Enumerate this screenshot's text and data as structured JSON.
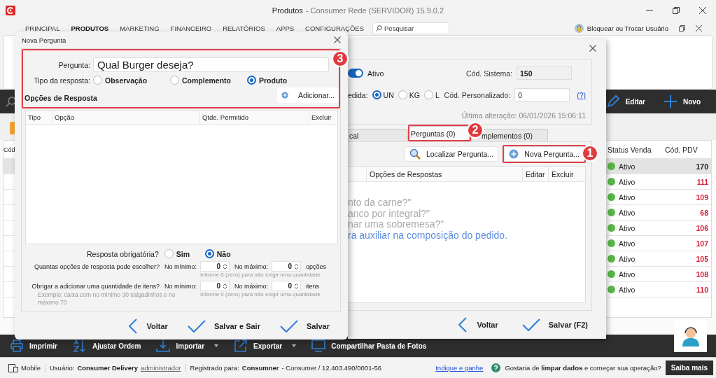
{
  "window": {
    "title": "Produtos",
    "subtitle": "- Consumer Rede (SERVIDOR) 15.9.0.2"
  },
  "menu": {
    "tabs": [
      {
        "label": "PRINCIPAL",
        "selected": false
      },
      {
        "label": "PRODUTOS",
        "selected": true
      },
      {
        "label": "MARKETING",
        "selected": false
      },
      {
        "label": "FINANCEIRO",
        "selected": false
      },
      {
        "label": "RELATÓRIOS",
        "selected": false
      },
      {
        "label": "APPS",
        "selected": false
      },
      {
        "label": "CONFIGURAÇÕES",
        "selected": false
      }
    ],
    "search": {
      "placeholder": "Pesquisar"
    },
    "user_action": "Bloquear ou Trocar Usuário"
  },
  "top_toolbar": {
    "buttons": [
      {
        "label": "Editar"
      },
      {
        "label": "Novo"
      }
    ]
  },
  "main_table": {
    "columns": [
      "Cód",
      "Status Venda",
      "Cód. PDV"
    ],
    "rows": [
      {
        "status": "Ativo",
        "code": "170",
        "selected": true
      },
      {
        "status": "Ativo",
        "code": "111",
        "selected": false
      },
      {
        "status": "Ativo",
        "code": "109",
        "selected": false
      },
      {
        "status": "Ativo",
        "code": "68",
        "selected": false
      },
      {
        "status": "Ativo",
        "code": "106",
        "selected": false
      },
      {
        "status": "Ativo",
        "code": "107",
        "selected": false
      },
      {
        "status": "Ativo",
        "code": "105",
        "selected": false
      },
      {
        "status": "Ativo",
        "code": "108",
        "selected": false
      },
      {
        "status": "Ativo",
        "code": "110",
        "selected": false
      }
    ]
  },
  "bottom_toolbar": {
    "buttons": [
      {
        "label": "Imprimir",
        "dropdown": false
      },
      {
        "label": "Ajustar Ordem",
        "dropdown": false
      },
      {
        "label": "Importar",
        "dropdown": true
      },
      {
        "label": "Exportar",
        "dropdown": true
      },
      {
        "label": "Compartilhar Pasta de Fotos",
        "dropdown": false
      }
    ]
  },
  "status_bar": {
    "mode": "Mobile",
    "user_label": "Usuário:",
    "user": "Consumer Delivery",
    "role": "administrador",
    "registered_label": "Registrado para:",
    "company": "Consumner",
    "company_rest": "- Consumer / 12.403.490/0001-56",
    "referral": "Indique e ganhe",
    "prompt": "Gostaria de **limpar dados** e começar sua operação?",
    "learn_more": "Saiba mais"
  },
  "product_dialog": {
    "active": {
      "label": "Ativo",
      "on": true
    },
    "system_code": {
      "label": "Cód. Sistema:",
      "value": "150"
    },
    "unit": {
      "label": "edida:",
      "options": [
        {
          "label": "UN",
          "selected": true
        },
        {
          "label": "KG",
          "selected": false
        },
        {
          "label": "L",
          "selected": false
        }
      ]
    },
    "custom_code": {
      "label": "Cód. Personalizado:",
      "value": "0",
      "help": "(?)"
    },
    "last_change": "Última alteração: 06/01/2026 15:06:11",
    "tabs": [
      {
        "label": "cal",
        "selected": false
      },
      {
        "label": "Perguntas (0)",
        "selected": true,
        "badge": "2"
      },
      {
        "label": "mplementos (0)",
        "selected": false
      }
    ],
    "buttons": [
      {
        "label": "Localizar Pergunta..."
      },
      {
        "label": "Nova Pergunta...",
        "badge": "1"
      }
    ],
    "table": {
      "columns": [
        "Opções de Respostas",
        "Editar",
        "Excluir"
      ]
    },
    "hint_lines": [
      {
        "text": "nto da carne?\"",
        "kind": "muted"
      },
      {
        "text": "anco por integral?\"",
        "kind": "muted"
      },
      {
        "text": "nar uma sobremesa?\"",
        "kind": "muted"
      },
      {
        "text": "ra auxiliar na composição do pedido.",
        "kind": "link"
      }
    ],
    "footer": [
      {
        "label": "Voltar",
        "kind": "back"
      },
      {
        "label": "Salvar (F2)",
        "kind": "save"
      }
    ]
  },
  "question_dialog": {
    "title": "Nova Pergunta",
    "badge": "3",
    "question": {
      "label": "Pergunta:",
      "value": "Qual Burger deseja?"
    },
    "answer_type": {
      "label": "Tipo da resposta:",
      "options": [
        {
          "label": "Observação",
          "selected": false
        },
        {
          "label": "Complemento",
          "selected": false
        },
        {
          "label": "Produto",
          "selected": true
        }
      ]
    },
    "options_title": "Opções de Resposta",
    "add_button": "Adicionar...",
    "table": {
      "columns": [
        "Tipo",
        "Opção",
        "Qtde. Permitido",
        "Excluir"
      ]
    },
    "required": {
      "label": "Resposta obrigatória?",
      "options": [
        {
          "label": "Sim",
          "selected": false
        },
        {
          "label": "Não",
          "selected": true
        }
      ]
    },
    "limits": [
      {
        "label": "Quantas opções de resposta pode escolher?",
        "min_label": "No mínimo:",
        "min": "0",
        "max_label": "No máximo:",
        "max": "0",
        "unit": "opções",
        "hint": "Informe 0 (zero) para não exigir uma quantidade"
      },
      {
        "label": "Obrigar a adicionar uma quantidade de itens?",
        "example": "Exemplo: caixa com no mínimo 30 salgadinhos e no máximo 70",
        "min_label": "No mínimo:",
        "min": "0",
        "max_label": "No máximo:",
        "max": "0",
        "unit": "itens",
        "hint": "Informe 0 (zero) para não exigir uma quantidade"
      }
    ],
    "footer": [
      {
        "label": "Voltar",
        "kind": "back"
      },
      {
        "label": "Salvar e Sair",
        "kind": "save"
      },
      {
        "label": "Salvar",
        "kind": "save"
      }
    ]
  }
}
